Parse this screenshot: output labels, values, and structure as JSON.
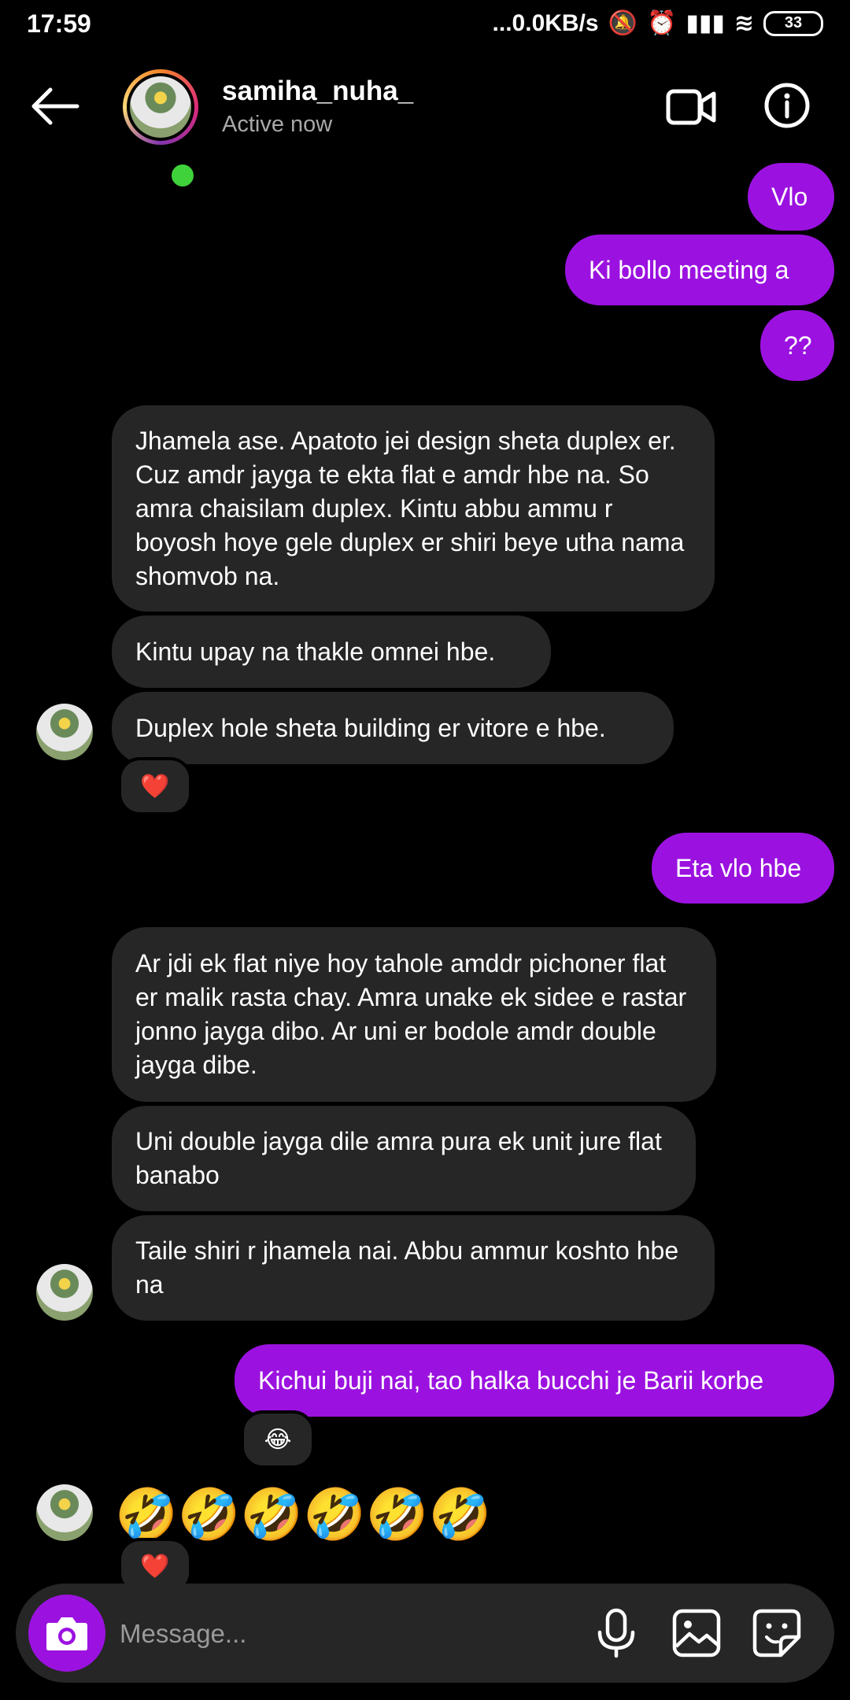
{
  "status_bar": {
    "time": "17:59",
    "network": "...0.0KB/s",
    "battery": "33"
  },
  "header": {
    "username": "samiha_nuha_",
    "status": "Active now"
  },
  "messages": [
    {
      "from": "me",
      "text": "Vlo"
    },
    {
      "from": "me",
      "text": "Ki bollo meeting a"
    },
    {
      "from": "me",
      "text": "??"
    },
    {
      "from": "them",
      "text": "Jhamela ase. Apatoto jei design sheta duplex er. Cuz amdr jayga te ekta flat e amdr hbe na. So amra chaisilam duplex. Kintu abbu ammu r boyosh hoye gele duplex er shiri beye utha nama shomvob na."
    },
    {
      "from": "them",
      "text": "Kintu upay na thakle omnei hbe."
    },
    {
      "from": "them",
      "text": "Duplex hole sheta building er vitore e hbe.",
      "reaction": "❤️"
    },
    {
      "from": "me",
      "text": "Eta vlo hbe"
    },
    {
      "from": "them",
      "text": "Ar jdi ek flat niye hoy tahole amddr pichoner flat er malik rasta chay. Amra unake ek sidee e rastar jonno jayga dibo. Ar uni er bodole amdr double jayga dibe."
    },
    {
      "from": "them",
      "text": "Uni double jayga dile amra pura ek unit jure flat banabo"
    },
    {
      "from": "them",
      "text": "Taile shiri r jhamela nai. Abbu ammur koshto hbe na"
    },
    {
      "from": "me",
      "text": "Kichui buji nai, tao halka bucchi je Barii korbe",
      "reaction": "😂"
    },
    {
      "from": "them",
      "text": "🤣🤣🤣🤣🤣🤣",
      "reaction": "❤️"
    }
  ],
  "composer": {
    "placeholder": "Message..."
  },
  "colors": {
    "sent_bubble": "#9b12e0",
    "received_bubble": "#262626",
    "online": "#3fd23a"
  },
  "icons": [
    "back-arrow-icon",
    "video-call-icon",
    "info-icon",
    "camera-icon",
    "microphone-icon",
    "gallery-icon",
    "sticker-icon"
  ]
}
